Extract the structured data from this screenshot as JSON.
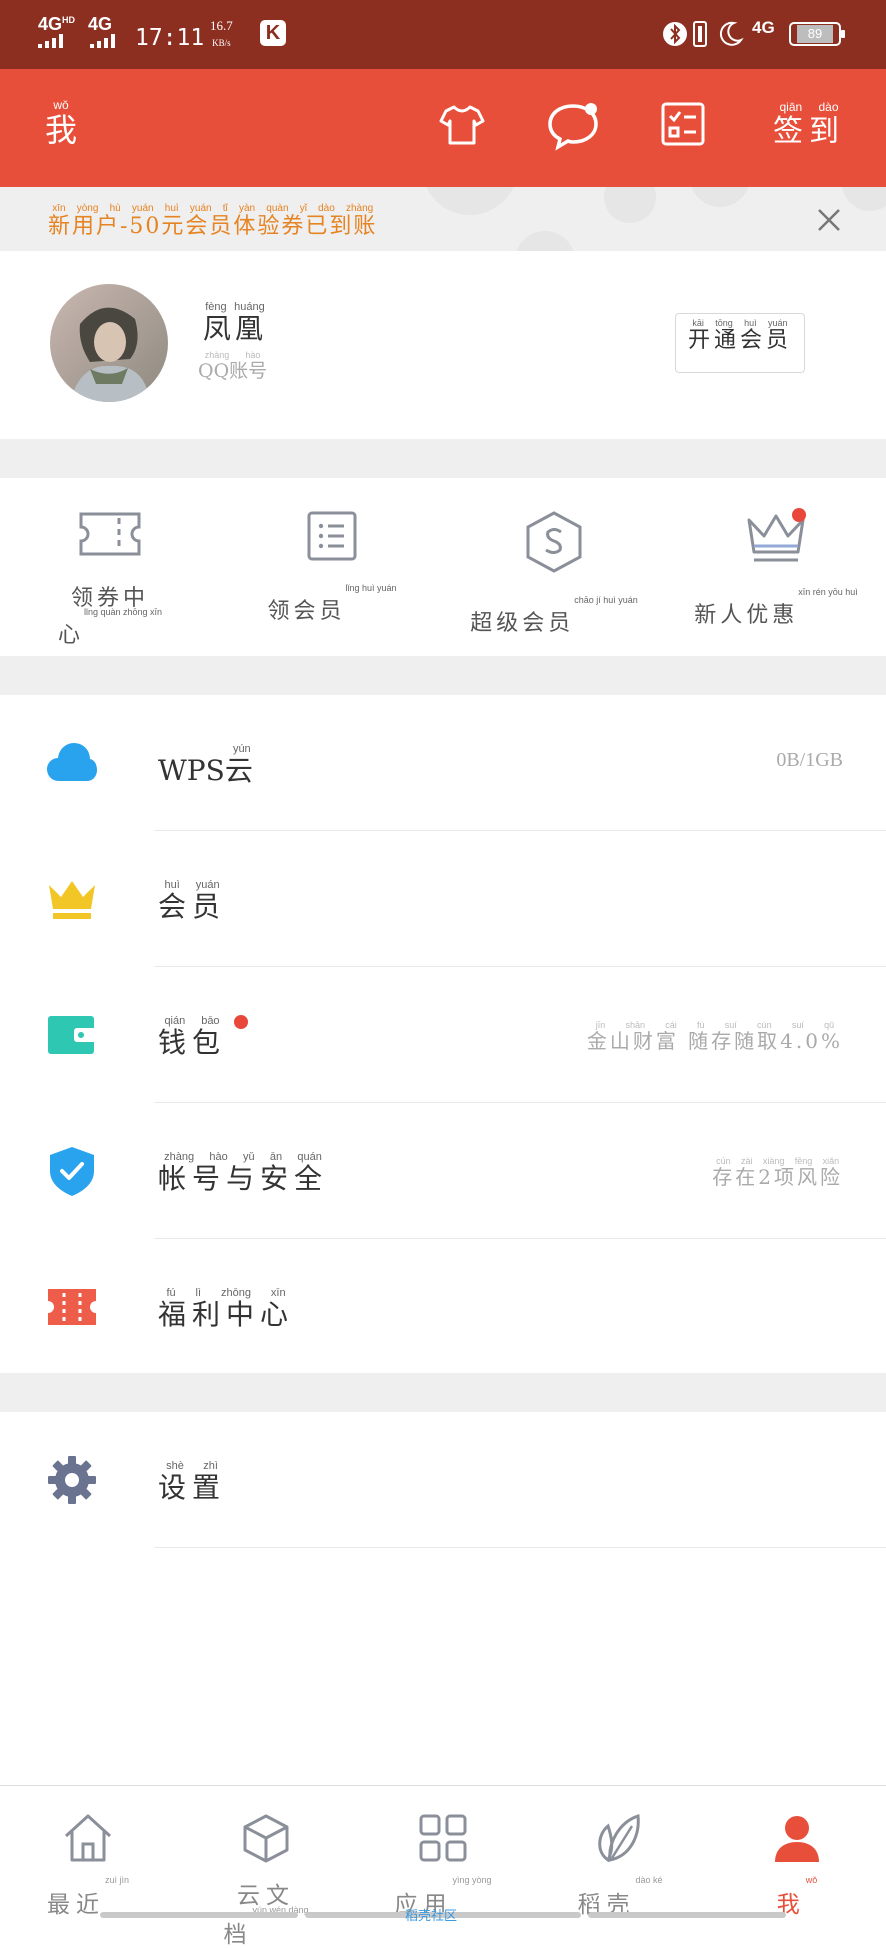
{
  "status_bar": {
    "signal1": "4G",
    "signal1_sup": "HD",
    "signal2": "4G",
    "time": "17:11",
    "speed_value": "16.7",
    "speed_unit": "KB/s",
    "app_badge": "K",
    "net": "4G",
    "battery": "89"
  },
  "header": {
    "title": "我",
    "title_pinyin": "wǒ",
    "icons": [
      "shirt-icon",
      "chat-icon",
      "checklist-icon"
    ],
    "signin_label": "签到",
    "signin_pinyin": "qiān dào",
    "background": "#e84f3a"
  },
  "notice": {
    "text": "新用户-50元会员体验券已到账",
    "pinyin": "xīn yòng hù yuán huì yuán tǐ yàn quàn yǐ dào zhàng",
    "color": "#e68322"
  },
  "profile": {
    "name": "凤凰",
    "name_pinyin": "fèng huáng",
    "account": "QQ账号",
    "account_pinyin": "zhàng hào",
    "vip_button": "开通会员",
    "vip_button_pinyin": "kāi tōng huì yuán"
  },
  "quick_actions": [
    {
      "label": "领券中心",
      "pinyin": "lǐng quàn zhōng xīn",
      "icon": "ticket-icon"
    },
    {
      "label": "领会员",
      "pinyin": "lǐng huì yuán",
      "icon": "list-icon"
    },
    {
      "label": "超级会员",
      "pinyin": "chāo jí huì yuán",
      "icon": "super-vip-icon"
    },
    {
      "label": "新人优惠",
      "pinyin": "xīn rén yōu huì",
      "icon": "crown-outline-icon"
    }
  ],
  "menu": [
    {
      "label": "WPS云",
      "pinyin": "yún",
      "value": "0B/1GB",
      "value_pinyin": "",
      "icon": "cloud-icon"
    },
    {
      "label": "会员",
      "pinyin": "huì yuán",
      "value": "",
      "icon": "crown-icon"
    },
    {
      "label": "钱包",
      "pinyin": "qián bāo",
      "value": "金山财富 随存随取4.0%",
      "value_pinyin": "jīn shān cái fù suí cún suí qǔ",
      "icon": "wallet-icon"
    },
    {
      "label": "帐号与安全",
      "pinyin": "zhàng hào yǔ ān quán",
      "value": "存在2项风险",
      "value_pinyin": "cún zài xiàng fēng xiǎn",
      "icon": "shield-icon"
    },
    {
      "label": "福利中心",
      "pinyin": "fú lì zhōng xīn",
      "value": "",
      "icon": "coupon-icon"
    },
    {
      "label": "设置",
      "pinyin": "shè zhì",
      "value": "",
      "icon": "gear-icon"
    }
  ],
  "bottom_nav": [
    {
      "label": "最近",
      "pinyin": "zuì jìn",
      "icon": "home-icon"
    },
    {
      "label": "云文档",
      "pinyin": "yún wén dàng",
      "icon": "cube-icon"
    },
    {
      "label": "应用",
      "pinyin": "yìng yòng",
      "icon": "apps-grid-icon"
    },
    {
      "label": "稻壳",
      "pinyin": "dào ké",
      "icon": "leaf-icon"
    },
    {
      "label": "我",
      "pinyin": "wǒ",
      "icon": "person-icon",
      "active": true
    }
  ],
  "community_label": "稻壳社区",
  "accent": "#e84f3a"
}
